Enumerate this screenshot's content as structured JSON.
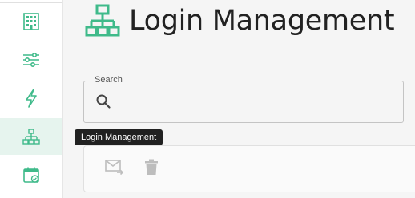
{
  "header": {
    "title": "Login Management",
    "icon": "sitemap-icon"
  },
  "sidebar": {
    "items": [
      {
        "name": "building-icon",
        "active": false
      },
      {
        "name": "sliders-icon",
        "active": false
      },
      {
        "name": "lightning-icon",
        "active": false
      },
      {
        "name": "sitemap-icon",
        "active": true
      },
      {
        "name": "calendar-check-icon",
        "active": false
      }
    ]
  },
  "search": {
    "label": "Search",
    "value": "",
    "placeholder": ""
  },
  "toolbar": {
    "actions": [
      "email-forward-icon",
      "delete-icon"
    ]
  },
  "tooltip": {
    "text": "Login Management"
  },
  "colors": {
    "accent": "#3fba8a",
    "active_bg": "#e6f4ee"
  }
}
